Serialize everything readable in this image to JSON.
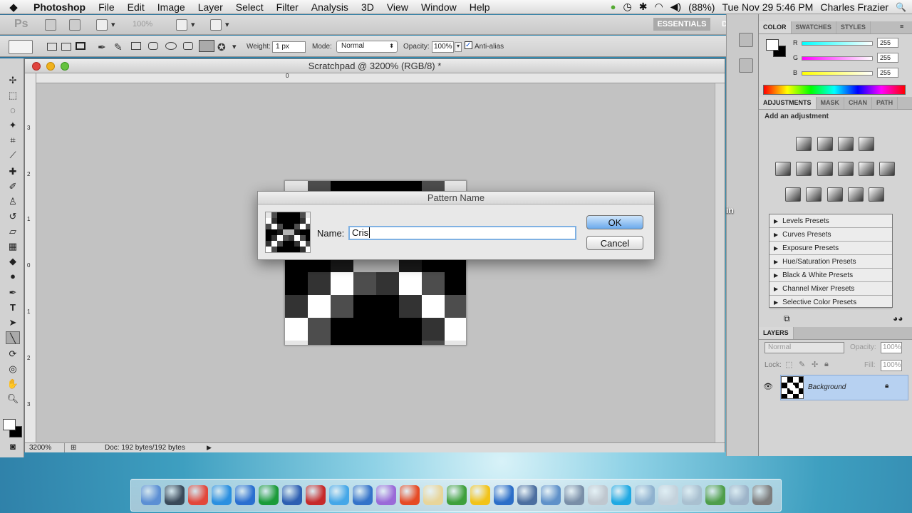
{
  "menubar": {
    "apple": "",
    "app_name": "Photoshop",
    "items": [
      "File",
      "Edit",
      "Image",
      "Layer",
      "Select",
      "Filter",
      "Analysis",
      "3D",
      "View",
      "Window",
      "Help"
    ],
    "battery": "(88%)",
    "datetime": "Tue Nov 29  5:46 PM",
    "user": "Charles Frazier",
    "search_icon": "🔍"
  },
  "app_bar": {
    "logo": "Ps",
    "zoom": "100%",
    "workspace": "ESSENTIALS",
    "workspace_next": "DE"
  },
  "options_bar": {
    "weight_label": "Weight:",
    "weight_value": "1 px",
    "mode_label": "Mode:",
    "mode_value": "Normal",
    "opacity_label": "Opacity:",
    "opacity_value": "100%",
    "antialias_label": "Anti-alias",
    "antialias_checked": true
  },
  "document": {
    "title": "Scratchpad @ 3200% (RGB/8) *",
    "ruler_h_zero": "0",
    "ruler_v_labels": [
      "3",
      "2",
      "1",
      "0",
      "1",
      "2",
      "3"
    ],
    "zoom": "3200%",
    "doc_info": "Doc: 192 bytes/192 bytes"
  },
  "pattern_grid": [
    [
      "#e6e6e6",
      "#4d4d4d",
      "#000000",
      "#000000",
      "#000000",
      "#000000",
      "#4d4d4d",
      "#e6e6e6"
    ],
    [
      "#ffffff",
      "#333333",
      "#000000",
      "#000000",
      "#000000",
      "#000000",
      "#333333",
      "#ffffff"
    ],
    [
      "#4d4d4d",
      "#ffffff",
      "#4d4d4d",
      "#000000",
      "#000000",
      "#4d4d4d",
      "#ffffff",
      "#4d4d4d"
    ],
    [
      "#000000",
      "#000000",
      "#1a1a1a",
      "#b3b3b3",
      "#b3b3b3",
      "#1a1a1a",
      "#000000",
      "#000000"
    ],
    [
      "#000000",
      "#333333",
      "#ffffff",
      "#4d4d4d",
      "#333333",
      "#ffffff",
      "#4d4d4d",
      "#000000"
    ],
    [
      "#333333",
      "#ffffff",
      "#4d4d4d",
      "#000000",
      "#000000",
      "#333333",
      "#ffffff",
      "#4d4d4d"
    ],
    [
      "#ffffff",
      "#4d4d4d",
      "#000000",
      "#000000",
      "#000000",
      "#000000",
      "#333333",
      "#ffffff"
    ],
    [
      "#e6e6e6",
      "#4d4d4d",
      "#000000",
      "#000000",
      "#000000",
      "#000000",
      "#4d4d4d",
      "#e6e6e6"
    ]
  ],
  "dialog": {
    "title": "Pattern Name",
    "name_label": "Name:",
    "name_value": "Cris",
    "ok_label": "OK",
    "cancel_label": "Cancel"
  },
  "color_panel": {
    "tabs": [
      "COLOR",
      "SWATCHES",
      "STYLES"
    ],
    "channels": [
      {
        "label": "R",
        "value": "255",
        "color": "#ff3b3b"
      },
      {
        "label": "G",
        "value": "255",
        "color": "#2fd64a"
      },
      {
        "label": "B",
        "value": "255",
        "color": "#3a6bff"
      }
    ]
  },
  "adjustments_panel": {
    "tabs": [
      "ADJUSTMENTS",
      "MASK",
      "CHAN",
      "PATH"
    ],
    "header": "Add an adjustment",
    "presets": [
      "Levels Presets",
      "Curves Presets",
      "Exposure Presets",
      "Hue/Saturation Presets",
      "Black & White Presets",
      "Channel Mixer Presets",
      "Selective Color Presets"
    ]
  },
  "layers_panel": {
    "title": "LAYERS",
    "blend_mode": "Normal",
    "opacity_label": "Opacity:",
    "opacity_value": "100%",
    "lock_label": "Lock:",
    "fill_label": "Fill:",
    "fill_value": "100%",
    "layer_name": "Background"
  },
  "desktop_partial_label": "in",
  "dock_colors": [
    "#5c8fd4",
    "#3a4a5a",
    "#e2473b",
    "#2a8fe0",
    "#2a6fd0",
    "#1b9b3a",
    "#2d5fb2",
    "#c62a2a",
    "#45a7e8",
    "#3473c9",
    "#9a6ad8",
    "#e64a24",
    "#e8d59a",
    "#3fa03c",
    "#f2c318",
    "#2b6ec8",
    "#4c6fa0",
    "#5f91c9",
    "#7a8fa8",
    "#bfc7cf",
    "#20a9e3",
    "#8fb2cf",
    "#c4d2dc",
    "#a9c0d0",
    "#4f9e4a",
    "#9db4c9",
    "#7d7d7d"
  ]
}
